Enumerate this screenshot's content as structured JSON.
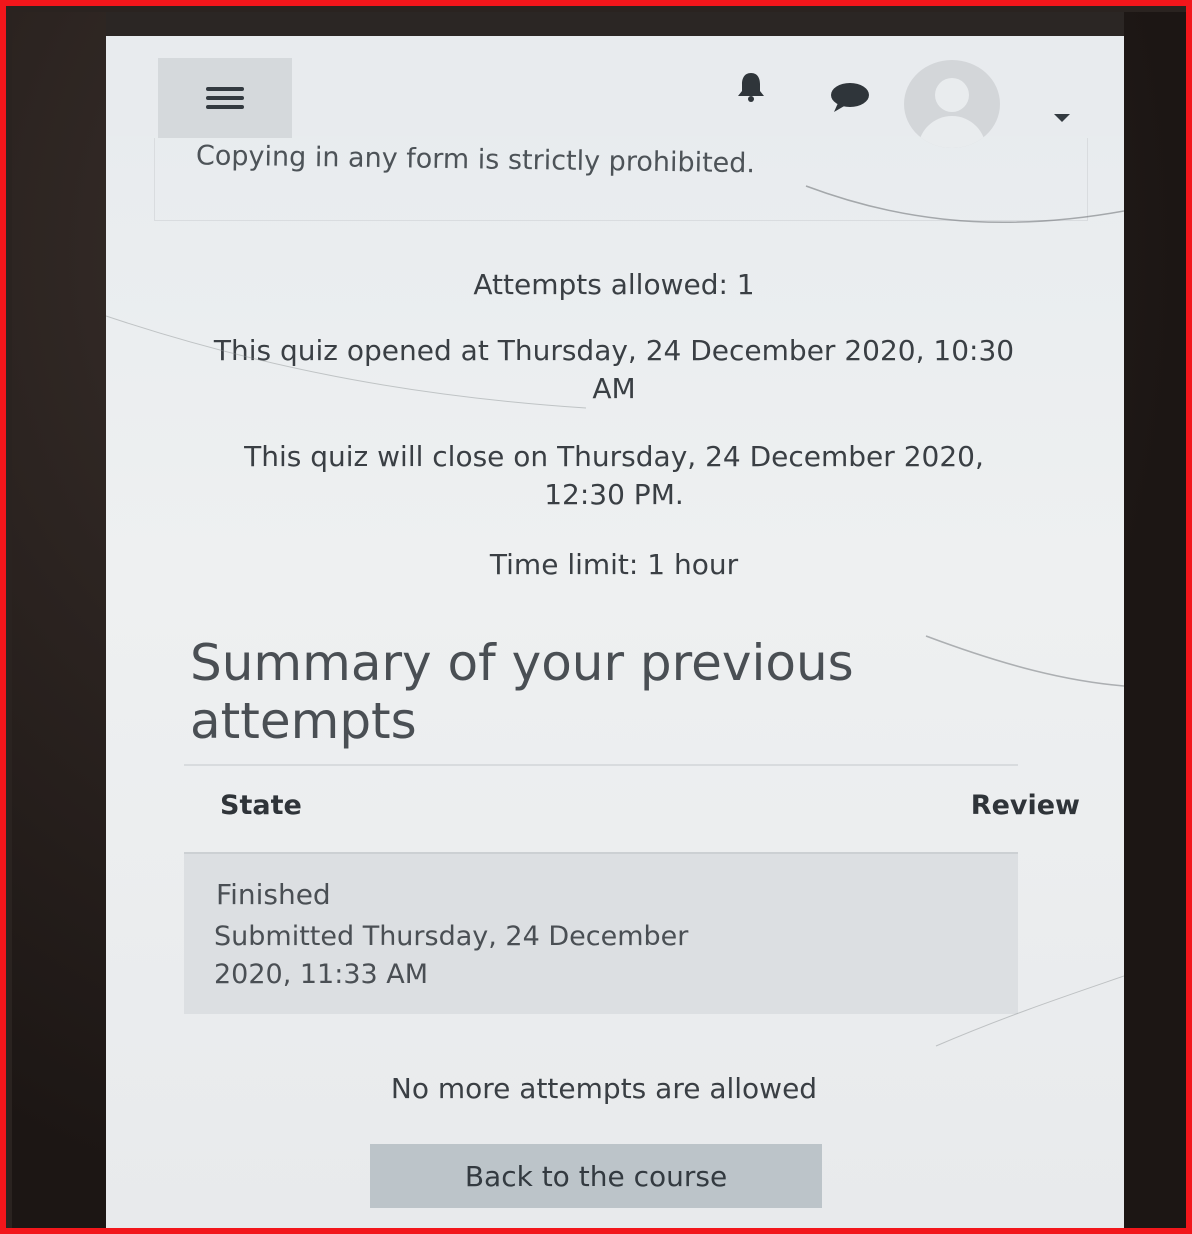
{
  "header": {
    "menu_icon": "hamburger-icon",
    "notification_icon": "bell-icon",
    "messages_icon": "chat-bubble-icon",
    "user_icon": "avatar-icon",
    "user_menu_icon": "chevron-down-icon"
  },
  "quiz_info": {
    "notice": "Copying in any form is strictly prohibited.",
    "attempts_allowed": "Attempts allowed: 1",
    "opened": "This quiz opened at Thursday, 24 December 2020, 10:30 AM",
    "closes": "This quiz will close on Thursday, 24 December 2020, 12:30 PM.",
    "time_limit": "Time limit: 1 hour"
  },
  "summary": {
    "title": "Summary of your previous attempts",
    "columns": [
      "State",
      "Review"
    ],
    "rows": [
      {
        "state": "Finished",
        "submitted": "Submitted Thursday, 24 December 2020, 11:33 AM"
      }
    ]
  },
  "footer": {
    "status": "No more attempts are allowed",
    "back_button": "Back to the course"
  },
  "colors": {
    "border": "#f2161b",
    "screen": "#e9ecee",
    "button": "#bcc4c9",
    "text": "#3a3f44"
  }
}
